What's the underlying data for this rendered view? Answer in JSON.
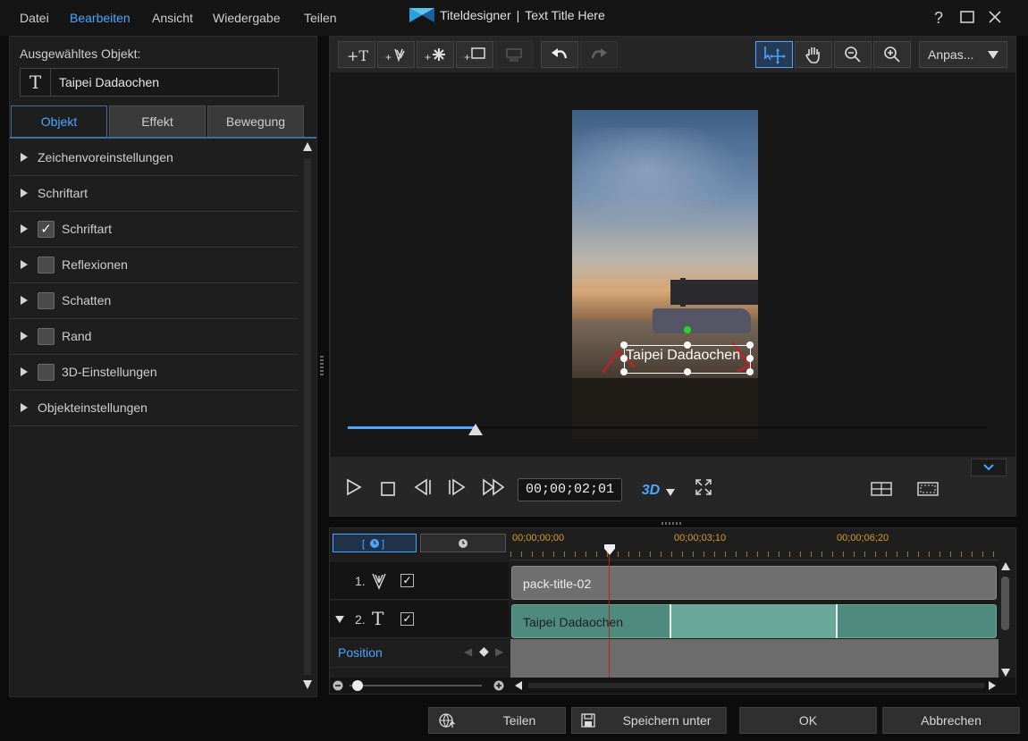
{
  "menu": [
    "Datei",
    "Bearbeiten",
    "Ansicht",
    "Wiedergabe",
    "Teilen"
  ],
  "window": {
    "app_name": "Titeldesigner",
    "separator": "|",
    "doc_title": "Text Title Here"
  },
  "left": {
    "selected_label": "Ausgewähltes Objekt:",
    "selected_value": "Taipei Dadaochen",
    "tabs": [
      "Objekt",
      "Effekt",
      "Bewegung"
    ],
    "props": [
      {
        "label": "Zeichenvoreinstellungen",
        "checkbox": false,
        "checked": false
      },
      {
        "label": "Schriftart",
        "checkbox": false,
        "checked": false
      },
      {
        "label": "Schriftart",
        "checkbox": true,
        "checked": true
      },
      {
        "label": "Reflexionen",
        "checkbox": true,
        "checked": false
      },
      {
        "label": "Schatten",
        "checkbox": true,
        "checked": false
      },
      {
        "label": "Rand",
        "checkbox": true,
        "checked": false
      },
      {
        "label": "3D-Einstellungen",
        "checkbox": true,
        "checked": false
      },
      {
        "label": "Objekteinstellungen",
        "checkbox": false,
        "checked": false
      }
    ]
  },
  "preview": {
    "zoom_select": "Anpas...",
    "title_text": "Taipei Dadaochen",
    "timecode": "00;00;02;01",
    "mode_3d": "3D",
    "seek_progress": 0.2
  },
  "timeline": {
    "ruler": [
      "00;00;00;00",
      "00;00;03;10",
      "00;00;06;20"
    ],
    "tracks": [
      {
        "index": "1.",
        "clip": "pack-title-02",
        "checked": true
      },
      {
        "index": "2.",
        "clip": "Taipei Dadaochen",
        "checked": true
      }
    ],
    "keyframe_label": "Position"
  },
  "buttons": {
    "share": "Teilen",
    "save_as": "Speichern unter",
    "ok": "OK",
    "cancel": "Abbrechen"
  },
  "colors": {
    "accent": "#4ca6ff",
    "clip_gray": "#6f6f6f",
    "clip_teal": "#4f8a7e",
    "clip_teal_light": "#6aa89a",
    "playhead": "#c21f1f",
    "ruler": "#d89b2a"
  }
}
